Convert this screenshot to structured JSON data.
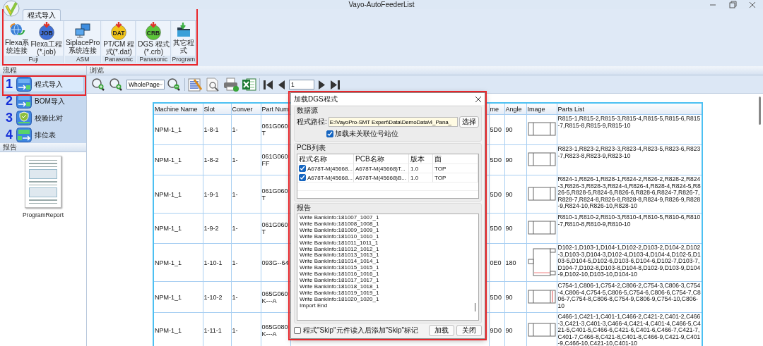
{
  "window": {
    "title": "Vayo-AutoFeederList"
  },
  "ribbon": {
    "tabs": [
      {
        "label": "程式导入",
        "selected": true
      }
    ],
    "groups": [
      {
        "label": "Fuji",
        "buttons": [
          {
            "lines": [
              "Flexa系",
              "统连接"
            ],
            "icon": {
              "kind": "globe"
            }
          },
          {
            "lines": [
              "Flexa工程",
              "(*.job)"
            ],
            "icon": {
              "kind": "badge",
              "text": "JOB",
              "color": "#3f6fd6"
            }
          }
        ]
      },
      {
        "label": "ASM",
        "buttons": [
          {
            "lines": [
              "SiplacePro",
              "系统连接"
            ],
            "icon": {
              "kind": "monitors"
            }
          }
        ]
      },
      {
        "label": "Panasonic",
        "buttons": [
          {
            "lines": [
              "PT/CM 程",
              "式(*.dat)"
            ],
            "icon": {
              "kind": "badge",
              "text": "DAT",
              "color": "#f0c419"
            }
          }
        ]
      },
      {
        "label": "Panasonic",
        "buttons": [
          {
            "lines": [
              "DGS 程式",
              "(*.crb)"
            ],
            "icon": {
              "kind": "badge",
              "text": "CRB",
              "color": "#5cc43a"
            }
          }
        ]
      },
      {
        "label": "Program",
        "buttons": [
          {
            "lines": [
              "其它程",
              "式"
            ],
            "icon": {
              "kind": "folder"
            }
          }
        ]
      }
    ]
  },
  "flow": {
    "header": "流程",
    "steps": [
      {
        "number": "1",
        "label": "程式导入",
        "selected": true,
        "icon": {
          "kind": "transfer-in"
        }
      },
      {
        "number": "2",
        "label": "BOM导入",
        "selected": false,
        "icon": {
          "kind": "transfer-in"
        }
      },
      {
        "number": "3",
        "label": "校验比对",
        "selected": false,
        "icon": {
          "kind": "shield"
        }
      },
      {
        "number": "4",
        "label": "排位表",
        "selected": false,
        "icon": {
          "kind": "transfer-out"
        }
      }
    ]
  },
  "report": {
    "header": "报告",
    "thumbnail_label": "ProgramReport"
  },
  "preview": {
    "header": "浏览",
    "zoom_select": "WholePage",
    "page": "1",
    "table": {
      "columns": [
        "Machine Name",
        "Slot",
        "Conver",
        "Part Num",
        "me",
        "Angle",
        "Image",
        "Parts List"
      ],
      "rows": [
        {
          "cells": [
            "NPM-1_1",
            "1-8-1",
            "1-",
            "061G060\nT",
            "5D0",
            "90"
          ],
          "image": {
            "kind": "chip"
          },
          "parts": "R815-1,R815-2,R815-3,R815-4,R815-5,R815-6,R815-7,R815-8,R815-9,R815-10"
        },
        {
          "cells": [
            "NPM-1_1",
            "1-8-2",
            "1-",
            "061G060\nFF",
            "5D0",
            "90"
          ],
          "image": {
            "kind": "chip"
          },
          "parts": "R823-1,R823-2,R823-3,R823-4,R823-5,R823-6,R823-7,R823-8,R823-9,R823-10"
        },
        {
          "cells": [
            "NPM-1_1",
            "1-9-1",
            "1-",
            "061G060\nT",
            "5D0",
            "90"
          ],
          "image": {
            "kind": "chip"
          },
          "parts": "R824-1,R826-1,R828-1,R824-2,R826-2,R828-2,R824-3,R826-3,R828-3,R824-4,R826-4,R828-4,R824-5,R826-5,R828-5,R824-6,R826-6,R828-6,R824-7,R826-7,R828-7,R824-8,R826-8,R828-8,R824-9,R826-9,R828-9,R824-10,R826-10,R828-10"
        },
        {
          "cells": [
            "NPM-1_1",
            "1-9-2",
            "1-",
            "061G060\nT",
            "5D0",
            "90"
          ],
          "image": {
            "kind": "chip"
          },
          "parts": "R810-1,R810-2,R810-3,R810-4,R810-5,R810-6,R810-7,R810-8,R810-9,R810-10"
        },
        {
          "cells": [
            "NPM-1_1",
            "1-10-1",
            "1-",
            "093G--64",
            "0E0",
            "180"
          ],
          "image": {
            "kind": "tall"
          },
          "parts": "D102-1,D103-1,D104-1,D102-2,D103-2,D104-2,D102-3,D103-3,D104-3,D102-4,D103-4,D104-4,D102-5,D103-5,D104-5,D102-6,D103-6,D104-6,D102-7,D103-7,D104-7,D102-8,D103-8,D104-8,D102-9,D103-9,D104-9,D102-10,D103-10,D104-10"
        },
        {
          "cells": [
            "NPM-1_1",
            "1-10-2",
            "1-",
            "065G060\nK---A",
            "5D0",
            "90"
          ],
          "image": {
            "kind": "marked"
          },
          "parts": "C754-1,C806-1,C754-2,C806-2,C754-3,C806-3,C754-4,C806-4,C754-5,C806-5,C754-6,C806-6,C754-7,C806-7,C754-8,C806-8,C754-9,C806-9,C754-10,C806-10"
        },
        {
          "cells": [
            "NPM-1_1",
            "1-11-1",
            "1-",
            "065G080\nK---A",
            "9D0",
            "90"
          ],
          "image": {
            "kind": "chip"
          },
          "parts": "C466-1,C421-1,C401-1,C466-2,C421-2,C401-2,C466-3,C421-3,C401-3,C466-4,C421-4,C401-4,C466-5,C421-5,C401-5,C466-6,C421-6,C401-6,C466-7,C421-7,C401-7,C466-8,C421-8,C401-8,C466-9,C421-9,C401-9,C466-10,C421-10,C401-10"
        }
      ]
    }
  },
  "dialog": {
    "title": "加载DGS程式",
    "source": {
      "legend": "数据源",
      "path_label": "程式路径:",
      "path": "E:\\VayoPro-SMT Expert\\Data\\DemoData\\4_Pana_",
      "browse_button": "选择",
      "load_unlinked": {
        "label": "加载未关联位号站位",
        "checked": true
      }
    },
    "pcb_list": {
      "legend": "PCB列表",
      "columns": [
        "程式名称",
        "PCB名称",
        "版本",
        "面"
      ],
      "rows": [
        {
          "checked": true,
          "cells": [
            "A678T-M(45668...",
            "A678T-M(45668)T...",
            "1.0",
            "TOP"
          ]
        },
        {
          "checked": true,
          "cells": [
            "A678T-M(45668...",
            "A678T-M(45668)B...",
            "1.0",
            "TOP"
          ]
        }
      ]
    },
    "report": {
      "legend": "报告",
      "lines": [
        "Write BankInfo:181007_1007_1",
        "Write BankInfo:181008_1008_1",
        "Write BankInfo:181009_1009_1",
        "Write BankInfo:181010_1010_1",
        "Write BankInfo:181011_1011_1",
        "Write BankInfo:181012_1012_1",
        "Write BankInfo:181013_1013_1",
        "Write BankInfo:181014_1014_1",
        "Write BankInfo:181015_1015_1",
        "Write BankInfo:181016_1016_1",
        "Write BankInfo:181017_1017_1",
        "Write BankInfo:181018_1018_1",
        "Write BankInfo:181019_1019_1",
        "Write BankInfo:181020_1020_1",
        "Import End"
      ]
    },
    "skip_mark": {
      "label": "程式\"Skip\"元件读入后添加\"Skip\"标记",
      "checked": false
    },
    "buttons": [
      "加载",
      "关闭"
    ]
  }
}
